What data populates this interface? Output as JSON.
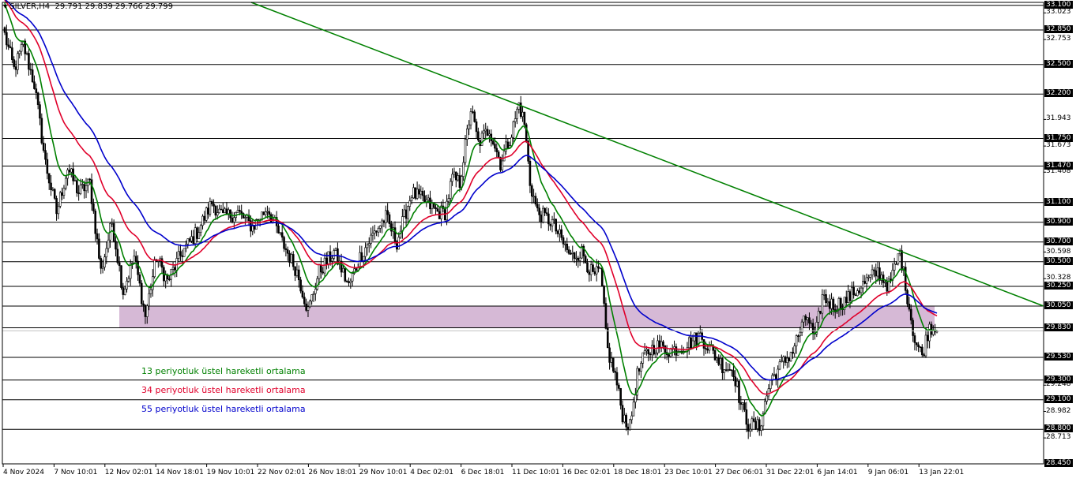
{
  "header": {
    "symbol_label": "SILVER,H4",
    "ohlc_values": "29.791 29.839 29.766 29.799"
  },
  "chart_data": {
    "type": "candlestick",
    "symbol": "SILVER",
    "timeframe": "H4",
    "ylim": [
      28.45,
      33.13
    ],
    "y_tick_labels": [
      "33.023",
      "32.753",
      "31.943",
      "31.673",
      "31.408",
      "30.598",
      "30.328",
      "29.248",
      "28.982",
      "28.713"
    ],
    "horizontal_levels": [
      33.1,
      32.85,
      32.5,
      32.2,
      31.75,
      31.47,
      31.1,
      30.9,
      30.7,
      30.5,
      30.25,
      30.05,
      29.83,
      29.53,
      29.3,
      29.1,
      28.8,
      28.45
    ],
    "current_price": 29.799,
    "x_tick_labels": [
      "4 Nov 2024",
      "7 Nov 10:01",
      "12 Nov 02:01",
      "14 Nov 18:01",
      "19 Nov 10:01",
      "22 Nov 02:01",
      "26 Nov 18:01",
      "29 Nov 10:01",
      "4 Dec 02:01",
      "6 Dec 18:01",
      "11 Dec 10:01",
      "16 Dec 02:01",
      "18 Dec 18:01",
      "23 Dec 10:01",
      "27 Dec 06:01",
      "31 Dec 22:01",
      "6 Jan 14:01",
      "9 Jan 06:01",
      "13 Jan 22:01"
    ],
    "support_zone": [
      29.83,
      30.05
    ],
    "trendline": {
      "from_price": 33.13,
      "to_price": 30.05
    },
    "close_path": [
      [
        0,
        32.8
      ],
      [
        5,
        32.45
      ],
      [
        10,
        32.7
      ],
      [
        16,
        32.3
      ],
      [
        22,
        31.5
      ],
      [
        28,
        31.0
      ],
      [
        34,
        31.45
      ],
      [
        40,
        31.2
      ],
      [
        46,
        31.3
      ],
      [
        52,
        30.4
      ],
      [
        58,
        30.9
      ],
      [
        64,
        30.2
      ],
      [
        70,
        30.55
      ],
      [
        76,
        29.95
      ],
      [
        82,
        30.55
      ],
      [
        88,
        30.3
      ],
      [
        96,
        30.6
      ],
      [
        104,
        30.8
      ],
      [
        112,
        31.1
      ],
      [
        118,
        30.95
      ],
      [
        126,
        31.0
      ],
      [
        134,
        30.85
      ],
      [
        142,
        31.05
      ],
      [
        150,
        30.7
      ],
      [
        158,
        30.4
      ],
      [
        164,
        30.0
      ],
      [
        170,
        30.4
      ],
      [
        178,
        30.6
      ],
      [
        186,
        30.25
      ],
      [
        192,
        30.55
      ],
      [
        200,
        30.8
      ],
      [
        206,
        30.95
      ],
      [
        212,
        30.7
      ],
      [
        220,
        31.2
      ],
      [
        228,
        31.1
      ],
      [
        234,
        31.0
      ],
      [
        238,
        31.0
      ],
      [
        242,
        31.35
      ],
      [
        246,
        31.3
      ],
      [
        252,
        32.05
      ],
      [
        256,
        31.7
      ],
      [
        262,
        31.85
      ],
      [
        268,
        31.5
      ],
      [
        274,
        31.8
      ],
      [
        278,
        32.1
      ],
      [
        281,
        31.9
      ],
      [
        284,
        31.3
      ],
      [
        288,
        31.0
      ],
      [
        292,
        30.95
      ],
      [
        296,
        30.9
      ],
      [
        300,
        30.75
      ],
      [
        306,
        30.55
      ],
      [
        312,
        30.6
      ],
      [
        318,
        30.35
      ],
      [
        322,
        30.4
      ],
      [
        326,
        29.6
      ],
      [
        330,
        29.35
      ],
      [
        334,
        28.95
      ],
      [
        338,
        28.82
      ],
      [
        342,
        29.35
      ],
      [
        346,
        29.55
      ],
      [
        352,
        29.65
      ],
      [
        360,
        29.6
      ],
      [
        368,
        29.65
      ],
      [
        376,
        29.75
      ],
      [
        382,
        29.6
      ],
      [
        388,
        29.45
      ],
      [
        394,
        29.4
      ],
      [
        398,
        29.05
      ],
      [
        402,
        28.85
      ],
      [
        408,
        28.82
      ],
      [
        414,
        29.3
      ],
      [
        420,
        29.45
      ],
      [
        426,
        29.6
      ],
      [
        430,
        29.8
      ],
      [
        434,
        29.95
      ],
      [
        438,
        29.7
      ],
      [
        442,
        30.15
      ],
      [
        448,
        30.05
      ],
      [
        454,
        30.1
      ],
      [
        460,
        30.2
      ],
      [
        466,
        30.3
      ],
      [
        472,
        30.4
      ],
      [
        478,
        30.25
      ],
      [
        484,
        30.6
      ],
      [
        488,
        30.15
      ],
      [
        492,
        29.7
      ],
      [
        496,
        29.55
      ],
      [
        500,
        29.85
      ],
      [
        504,
        29.8
      ]
    ],
    "indicators": [
      {
        "name": "13 periyotluk üstel hareketli ortalama",
        "color": "#008000",
        "period": 13
      },
      {
        "name": "34 periyotluk üstel hareketli ortalama",
        "color": "#e0002b",
        "period": 34
      },
      {
        "name": "55 periyotluk üstel hareketli ortalama",
        "color": "#0000cc",
        "period": 55
      }
    ]
  }
}
